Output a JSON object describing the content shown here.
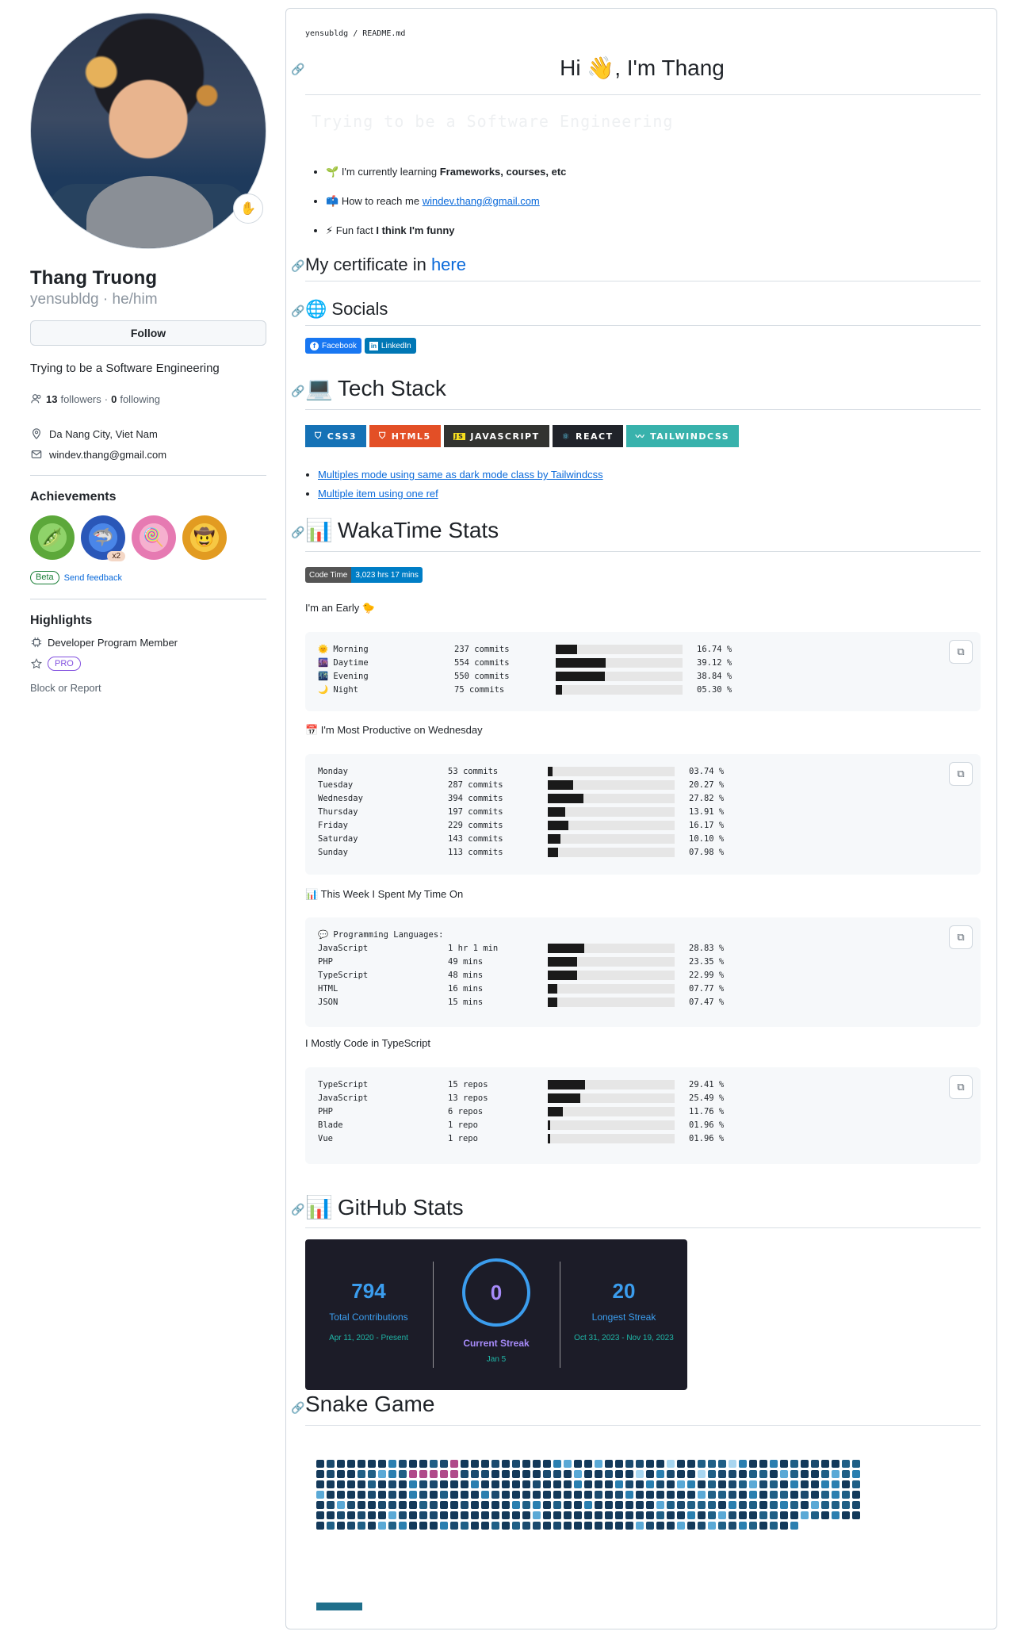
{
  "profile": {
    "name": "Thang Truong",
    "login": "yensubldg",
    "pronouns": "he/him",
    "follow_label": "Follow",
    "bio": "Trying to be a Software Engineering",
    "followers_count": "13",
    "followers_label": "followers",
    "following_count": "0",
    "following_label": "following",
    "location": "Da Nang City, Viet Nam",
    "email": "windev.thang@gmail.com",
    "achievements_title": "Achievements",
    "achievement_multiplier": "x2",
    "beta_label": "Beta",
    "feedback_label": "Send feedback",
    "highlights_title": "Highlights",
    "highlight_developer": "Developer Program Member",
    "pro_label": "PRO",
    "block_label": "Block or Report"
  },
  "readme": {
    "breadcrumb": "yensubldg / README.md",
    "greeting": "Hi 👋, I'm Thang",
    "typing": "Trying to be a Software Engineering",
    "bullets": [
      {
        "icon": "🌱",
        "text": "I'm currently learning ",
        "bold": "Frameworks, courses, etc"
      },
      {
        "icon": "📫",
        "text": "How to reach me ",
        "link": "windev.thang@gmail.com"
      },
      {
        "icon": "⚡",
        "text": "Fun fact ",
        "bold": "I think I'm funny"
      }
    ],
    "cert_heading": "My certificate in ",
    "cert_link": "here",
    "socials_heading": "Socials",
    "socials": [
      "Facebook",
      "LinkedIn"
    ],
    "tech_heading": "Tech Stack",
    "tech": [
      {
        "label": "CSS3",
        "color": "#1572B6"
      },
      {
        "label": "HTML5",
        "color": "#E34F26"
      },
      {
        "label": "JAVASCRIPT",
        "color": "#323330"
      },
      {
        "label": "REACT",
        "color": "#20232A"
      },
      {
        "label": "TAILWINDCSS",
        "color": "#38B2AC"
      }
    ],
    "tech_links": [
      "Multiples mode using same as dark mode class by Tailwindcss",
      "Multiple item using one ref"
    ],
    "waka_heading": "WakaTime Stats",
    "code_time_label": "Code Time",
    "code_time_value": "3,023 hrs 17 mins",
    "early_heading": "I'm an Early 🐤",
    "early": [
      {
        "icon": "🌞",
        "label": "Morning",
        "value": "237 commits",
        "pct": 16.74,
        "pct_text": "16.74 %"
      },
      {
        "icon": "🌆",
        "label": "Daytime",
        "value": "554 commits",
        "pct": 39.12,
        "pct_text": "39.12 %"
      },
      {
        "icon": "🌃",
        "label": "Evening",
        "value": "550 commits",
        "pct": 38.84,
        "pct_text": "38.84 %"
      },
      {
        "icon": "🌙",
        "label": "Night",
        "value": "75 commits",
        "pct": 5.3,
        "pct_text": "05.30 %"
      }
    ],
    "productive_heading": "📅 I'm Most Productive on Wednesday",
    "days": [
      {
        "label": "Monday",
        "value": "53 commits",
        "pct": 3.74,
        "pct_text": "03.74 %"
      },
      {
        "label": "Tuesday",
        "value": "287 commits",
        "pct": 20.27,
        "pct_text": "20.27 %"
      },
      {
        "label": "Wednesday",
        "value": "394 commits",
        "pct": 27.82,
        "pct_text": "27.82 %"
      },
      {
        "label": "Thursday",
        "value": "197 commits",
        "pct": 13.91,
        "pct_text": "13.91 %"
      },
      {
        "label": "Friday",
        "value": "229 commits",
        "pct": 16.17,
        "pct_text": "16.17 %"
      },
      {
        "label": "Saturday",
        "value": "143 commits",
        "pct": 10.1,
        "pct_text": "10.10 %"
      },
      {
        "label": "Sunday",
        "value": "113 commits",
        "pct": 7.98,
        "pct_text": "07.98 %"
      }
    ],
    "week_heading": "📊 This Week I Spent My Time On",
    "week_sub": "💬 Programming Languages:",
    "languages": [
      {
        "label": "JavaScript",
        "value": "1 hr 1 min",
        "pct": 28.83,
        "pct_text": "28.83 %"
      },
      {
        "label": "PHP",
        "value": "49 mins",
        "pct": 23.35,
        "pct_text": "23.35 %"
      },
      {
        "label": "TypeScript",
        "value": "48 mins",
        "pct": 22.99,
        "pct_text": "22.99 %"
      },
      {
        "label": "HTML",
        "value": "16 mins",
        "pct": 7.77,
        "pct_text": "07.77 %"
      },
      {
        "label": "JSON",
        "value": "15 mins",
        "pct": 7.47,
        "pct_text": "07.47 %"
      }
    ],
    "mostly_heading": "I Mostly Code in TypeScript",
    "repos": [
      {
        "label": "TypeScript",
        "value": "15 repos",
        "pct": 29.41,
        "pct_text": "29.41 %"
      },
      {
        "label": "JavaScript",
        "value": "13 repos",
        "pct": 25.49,
        "pct_text": "25.49 %"
      },
      {
        "label": "PHP",
        "value": "6 repos",
        "pct": 11.76,
        "pct_text": "11.76 %"
      },
      {
        "label": "Blade",
        "value": "1 repo",
        "pct": 1.96,
        "pct_text": "01.96 %"
      },
      {
        "label": "Vue",
        "value": "1 repo",
        "pct": 1.96,
        "pct_text": "01.96 %"
      }
    ],
    "github_heading": "GitHub Stats",
    "streak": {
      "total": "794",
      "total_label": "Total Contributions",
      "total_range": "Apr 11, 2020 - Present",
      "current": "0",
      "current_label": "Current Streak",
      "current_date": "Jan 5",
      "longest": "20",
      "longest_label": "Longest Streak",
      "longest_range": "Oct 31, 2023 - Nov 19, 2023"
    },
    "snake_heading": "Snake Game"
  }
}
